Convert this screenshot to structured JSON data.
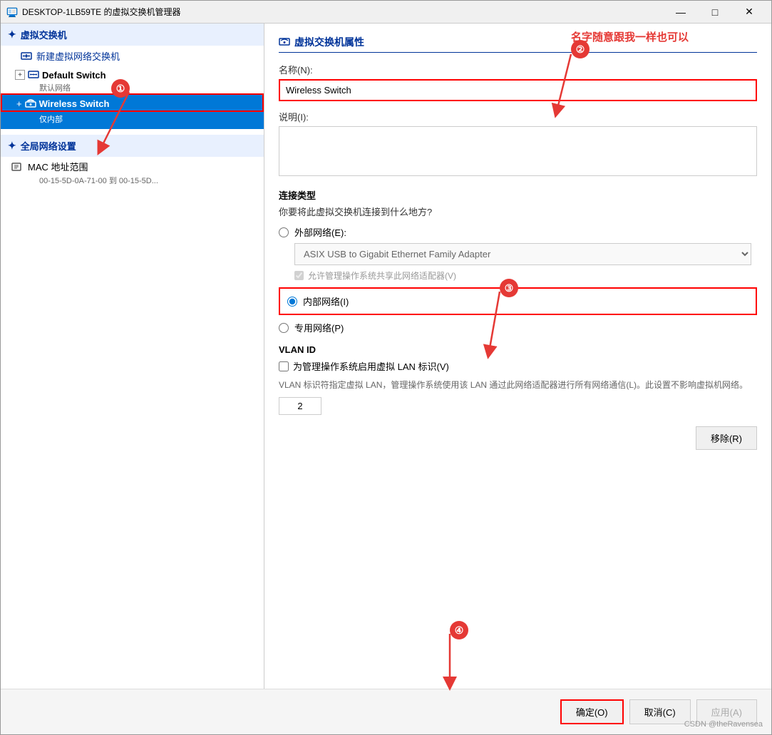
{
  "window": {
    "title": "DESKTOP-1LB59TE 的虚拟交换机管理器",
    "min_btn": "—",
    "max_btn": "□",
    "close_btn": "✕"
  },
  "left_panel": {
    "virtual_switch_header": "虚拟交换机",
    "new_switch_label": "新建虚拟网络交换机",
    "default_switch": {
      "label": "Default Switch",
      "sub_label": "默认网络"
    },
    "wireless_switch": {
      "label": "Wireless Switch",
      "sub_label": "仅内部"
    },
    "global_network_header": "全局网络设置",
    "mac_address": {
      "label": "MAC 地址范围",
      "value": "00-15-5D-0A-71-00 到 00-15-5D..."
    }
  },
  "right_panel": {
    "props_header": "虚拟交换机属性",
    "name_label": "名称(N):",
    "name_value": "Wireless Switch",
    "description_label": "说明(I):",
    "connection_type": {
      "title": "连接类型",
      "desc": "你要将此虚拟交换机连接到什么地方?",
      "options": [
        {
          "id": "external",
          "label": "外部网络(E):",
          "checked": false
        },
        {
          "id": "internal",
          "label": "内部网络(I)",
          "checked": true
        },
        {
          "id": "private",
          "label": "专用网络(P)",
          "checked": false
        }
      ],
      "adapter_dropdown": "ASIX USB to Gigabit Ethernet Family Adapter",
      "allow_management_label": "允许管理操作系统共享此网络适配器(V)"
    },
    "vlan": {
      "title": "VLAN ID",
      "checkbox_label": "为管理操作系统启用虚拟 LAN 标识(V)",
      "description": "VLAN 标识符指定虚拟 LAN，管理操作系统使用该 LAN 通过此网络适配器进行所有网络通信(L)。此设置不影响虚拟机网络。",
      "value": "2"
    },
    "remove_btn": "移除(R)",
    "ok_btn": "确定(O)",
    "cancel_btn": "取消(C)",
    "apply_btn": "应用(A)"
  },
  "annotations": {
    "1": "①",
    "2": "②",
    "3": "③",
    "4": "④",
    "note": "名字随意跟我一样也可以"
  },
  "watermark": "CSDN @theRavensea"
}
